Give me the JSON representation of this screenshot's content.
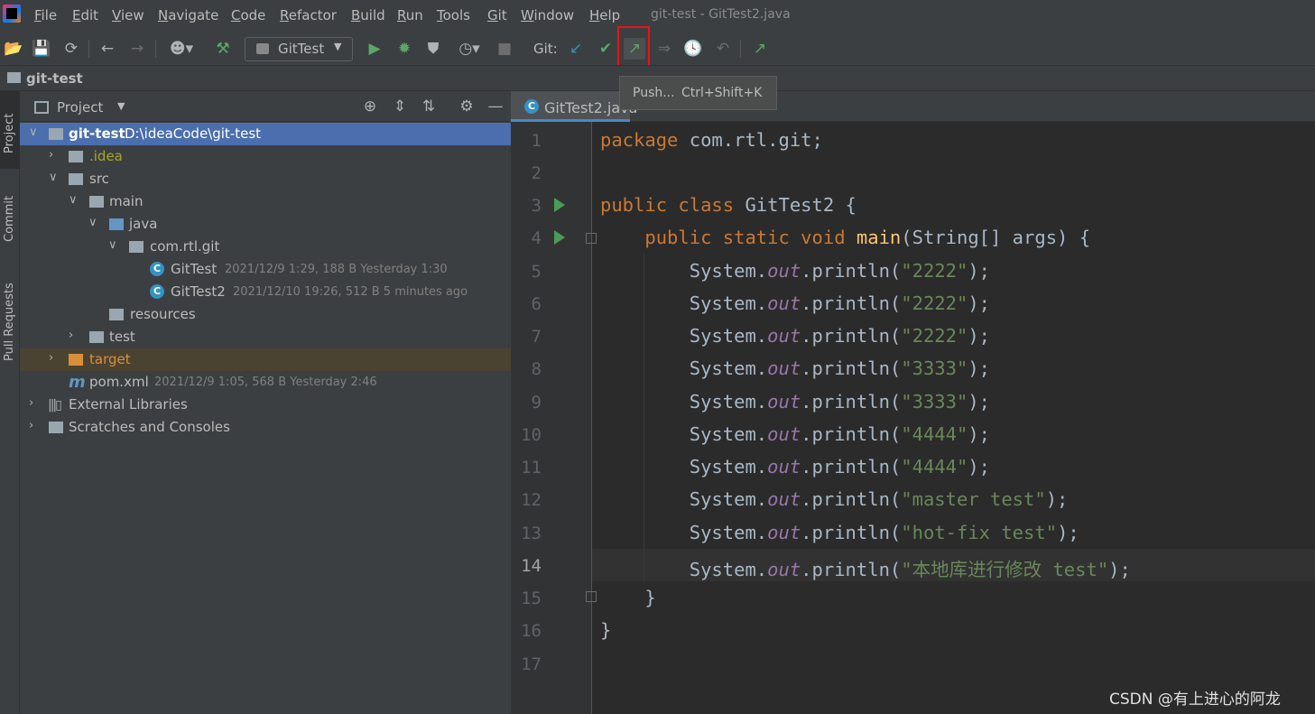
{
  "window": {
    "title": "git-test - GitTest2.java"
  },
  "menu": [
    "File",
    "Edit",
    "View",
    "Navigate",
    "Code",
    "Refactor",
    "Build",
    "Run",
    "Tools",
    "Git",
    "Window",
    "Help"
  ],
  "toolbar": {
    "run_config": "GitTest",
    "git_label": "Git:"
  },
  "tooltip": {
    "action": "Push...",
    "shortcut": "Ctrl+Shift+K"
  },
  "breadcrumb": {
    "project": "git-test"
  },
  "left_strip": [
    "Project",
    "Commit",
    "Pull Requests"
  ],
  "project_panel": {
    "title": "Project",
    "tree": [
      {
        "name": "git-test",
        "meta": "D:\\ideaCode\\git-test"
      },
      {
        "name": ".idea"
      },
      {
        "name": "src"
      },
      {
        "name": "main"
      },
      {
        "name": "java"
      },
      {
        "name": "com.rtl.git"
      },
      {
        "name": "GitTest",
        "meta": "2021/12/9 1:29, 188 B Yesterday 1:30"
      },
      {
        "name": "GitTest2",
        "meta": "2021/12/10 19:26, 512 B 5 minutes ago"
      },
      {
        "name": "resources"
      },
      {
        "name": "test"
      },
      {
        "name": "target"
      },
      {
        "name": "pom.xml",
        "meta": "2021/12/9 1:05, 568 B Yesterday 2:46"
      },
      {
        "name": "External Libraries"
      },
      {
        "name": "Scratches and Consoles"
      }
    ]
  },
  "editor": {
    "tab": "GitTest2.java",
    "line_numbers": [
      "1",
      "2",
      "3",
      "4",
      "5",
      "6",
      "7",
      "8",
      "9",
      "10",
      "11",
      "12",
      "13",
      "14",
      "15",
      "16",
      "17"
    ],
    "current_line": 14,
    "strings": [
      "\"2222\"",
      "\"2222\"",
      "\"2222\"",
      "\"3333\"",
      "\"3333\"",
      "\"4444\"",
      "\"4444\"",
      "\"master test\"",
      "\"hot-fix test\"",
      "\"本地库进行修改 test\""
    ]
  },
  "watermark": "CSDN @有上进心的阿龙"
}
